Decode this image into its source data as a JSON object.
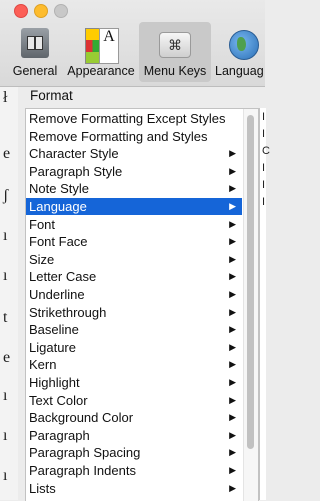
{
  "window": {
    "toolbar": [
      {
        "id": "general",
        "label": "General",
        "icon": "general-switch-icon"
      },
      {
        "id": "appearance",
        "label": "Appearance",
        "icon": "appearance-palette-icon"
      },
      {
        "id": "menukeys",
        "label": "Menu Keys",
        "icon": "command-key-icon",
        "selected": true,
        "glyph": "⌘"
      },
      {
        "id": "language",
        "label": "Languag",
        "icon": "globe-icon"
      }
    ],
    "appearance_glyph": "A"
  },
  "format": {
    "label": "Format",
    "items": [
      {
        "label": "Remove Formatting Except Styles",
        "submenu": false
      },
      {
        "label": "Remove Formatting and Styles",
        "submenu": false
      },
      {
        "label": "Character Style",
        "submenu": true
      },
      {
        "label": "Paragraph Style",
        "submenu": true
      },
      {
        "label": "Note Style",
        "submenu": true
      },
      {
        "label": "Language",
        "submenu": true,
        "selected": true
      },
      {
        "label": "Font",
        "submenu": true
      },
      {
        "label": "Font Face",
        "submenu": true
      },
      {
        "label": "Size",
        "submenu": true
      },
      {
        "label": "Letter Case",
        "submenu": true
      },
      {
        "label": "Underline",
        "submenu": true
      },
      {
        "label": "Strikethrough",
        "submenu": true
      },
      {
        "label": "Baseline",
        "submenu": true
      },
      {
        "label": "Ligature",
        "submenu": true
      },
      {
        "label": "Kern",
        "submenu": true
      },
      {
        "label": "Highlight",
        "submenu": true
      },
      {
        "label": "Text Color",
        "submenu": true
      },
      {
        "label": "Background Color",
        "submenu": true
      },
      {
        "label": "Paragraph",
        "submenu": true
      },
      {
        "label": "Paragraph Spacing",
        "submenu": true
      },
      {
        "label": "Paragraph Indents",
        "submenu": true
      },
      {
        "label": "Lists",
        "submenu": true
      }
    ],
    "arrow_glyph": "▶"
  },
  "left_strip_glyphs": [
    "ł",
    "e",
    "ʃ",
    "ı",
    "ı",
    "t",
    "e",
    "ı",
    "ı",
    "ı"
  ],
  "right_column_chars": [
    "I",
    "I",
    "C",
    "I",
    "I",
    "I"
  ],
  "colors": {
    "selection": "#1565d8"
  }
}
